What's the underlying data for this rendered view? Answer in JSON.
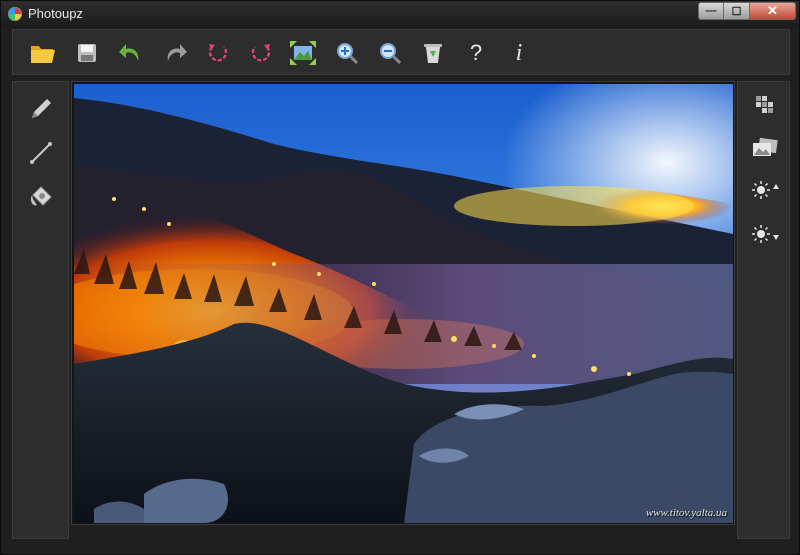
{
  "window": {
    "title": "Photoupz",
    "controls": {
      "minimize": "—",
      "maximize": "☐",
      "close": "✕"
    }
  },
  "toolbar": {
    "tools": [
      {
        "name": "open-folder-icon",
        "tooltip": ""
      },
      {
        "name": "save-icon",
        "tooltip": ""
      },
      {
        "name": "undo-icon",
        "tooltip": ""
      },
      {
        "name": "redo-icon",
        "tooltip": ""
      },
      {
        "name": "rotate-left-icon",
        "tooltip": ""
      },
      {
        "name": "rotate-right-icon",
        "tooltip": ""
      },
      {
        "name": "fit-to-window-icon",
        "tooltip": ""
      },
      {
        "name": "zoom-in-icon",
        "tooltip": ""
      },
      {
        "name": "zoom-out-icon",
        "tooltip": ""
      },
      {
        "name": "recycle-bin-icon",
        "tooltip": ""
      }
    ],
    "help_label": "?",
    "info_label": "i"
  },
  "left_panel": {
    "tools": [
      "pencil-icon",
      "line-icon",
      "paint-bucket-icon"
    ]
  },
  "right_panel": {
    "tools": [
      "mosaic-icon",
      "photos-icon",
      "brightness-up-icon",
      "brightness-down-icon"
    ]
  },
  "photo": {
    "watermark": "www.titov.yalta.ua",
    "colors": {
      "sky": "#1f6fd8",
      "fire": "#ff7a00",
      "glow": "#ffd24a",
      "haze": "#8a6fb8"
    }
  }
}
